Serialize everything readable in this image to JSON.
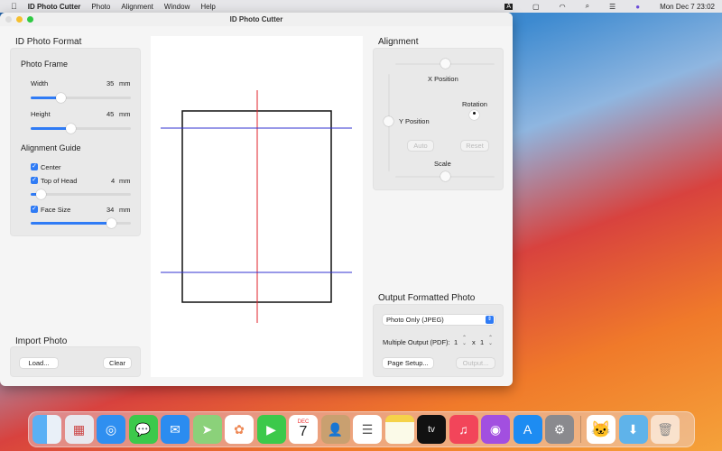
{
  "menubar": {
    "app": "ID Photo Cutter",
    "items": [
      "Photo",
      "Alignment",
      "Window",
      "Help"
    ],
    "clock": "Mon Dec 7  23:02"
  },
  "window": {
    "title": "ID Photo Cutter"
  },
  "format": {
    "title": "ID Photo Format",
    "frame_title": "Photo Frame",
    "width_label": "Width",
    "width_value": "35",
    "height_label": "Height",
    "height_value": "45",
    "unit": "mm",
    "width_slider": 0.3,
    "height_slider": 0.4,
    "guide_title": "Alignment Guide",
    "center_label": "Center",
    "top_label": "Top of Head",
    "top_value": "4",
    "top_slider": 0.1,
    "face_label": "Face Size",
    "face_value": "34",
    "face_slider": 0.8
  },
  "import": {
    "title": "Import Photo",
    "load": "Load...",
    "clear": "Clear"
  },
  "alignment": {
    "title": "Alignment",
    "x_label": "X Position",
    "y_label": "Y Position",
    "rotation_label": "Rotation",
    "auto": "Auto",
    "reset": "Reset",
    "scale_label": "Scale"
  },
  "output": {
    "title": "Output Formatted Photo",
    "format_select": "Photo Only (JPEG)",
    "multiple_label": "Multiple Output (PDF):",
    "cols": "1",
    "x": "x",
    "rows": "1",
    "page_setup": "Page Setup...",
    "output_btn": "Output..."
  },
  "dock": {
    "calendar_month": "DEC",
    "calendar_day": "7",
    "apps": [
      "finder",
      "launchpad",
      "safari",
      "messages",
      "mail",
      "maps",
      "photos",
      "facetime",
      "calendar",
      "contacts",
      "reminders",
      "notes",
      "tv",
      "music",
      "podcasts",
      "app-store",
      "system-preferences",
      "id-photo-cutter",
      "downloads",
      "trash"
    ]
  }
}
